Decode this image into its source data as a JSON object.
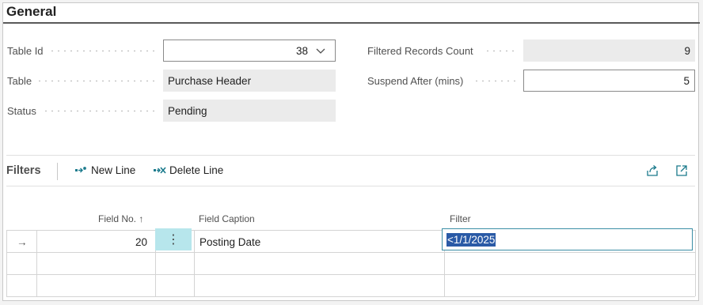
{
  "general": {
    "title": "General",
    "table_id_label": "Table Id",
    "table_id_value": "38",
    "table_label": "Table",
    "table_value": "Purchase Header",
    "status_label": "Status",
    "status_value": "Pending",
    "filtered_label": "Filtered Records Count",
    "filtered_value": "9",
    "suspend_label": "Suspend After (mins)",
    "suspend_value": "5"
  },
  "filters": {
    "title": "Filters",
    "new_line_label": "New Line",
    "delete_line_label": "Delete Line",
    "columns": {
      "field_no": "Field No.",
      "sort_arrow": "↑",
      "field_caption": "Field Caption",
      "filter": "Filter"
    },
    "rows": [
      {
        "indicator": "→",
        "field_no": "20",
        "field_caption": "Posting Date",
        "filter": "<1/1/2025"
      }
    ],
    "more_glyph": "⋮"
  },
  "colors": {
    "accent": "#1a7a8c",
    "selected_cell": "#b7e6ec",
    "selection": "#2a5aa6",
    "readonly_bg": "#ebebeb"
  },
  "icons": [
    "chevron-down-icon",
    "new-line-icon",
    "delete-line-icon",
    "share-icon",
    "expand-icon",
    "row-arrow-icon"
  ]
}
